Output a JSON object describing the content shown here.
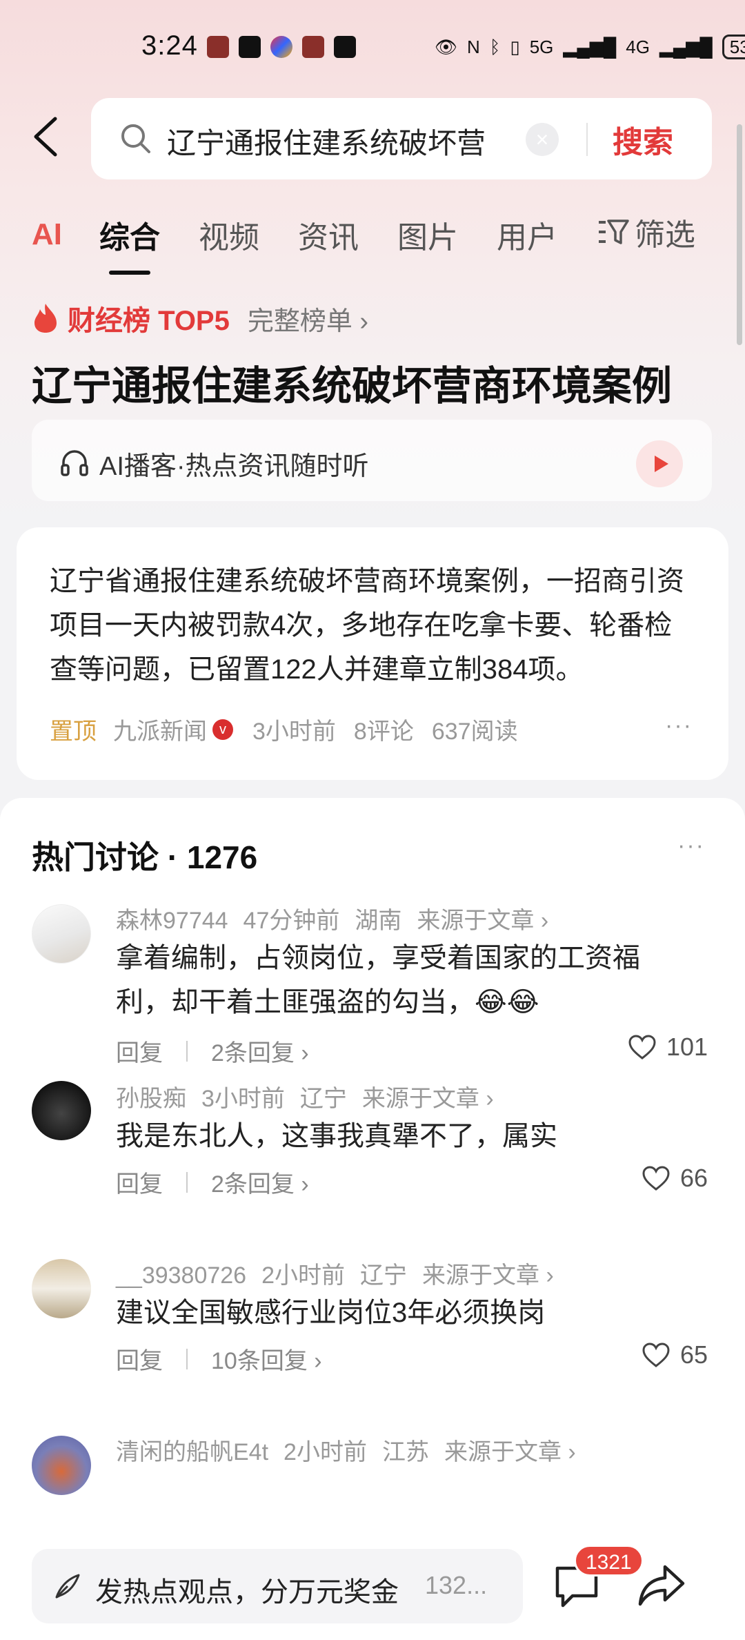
{
  "status_bar": {
    "time": "3:24",
    "signal_5g": "5G",
    "signal_4g": "4G",
    "battery": "53"
  },
  "search": {
    "query": "辽宁通报住建系统破坏营",
    "button_label": "搜索"
  },
  "tabs": [
    {
      "label": "AI"
    },
    {
      "label": "综合"
    },
    {
      "label": "视频"
    },
    {
      "label": "资讯"
    },
    {
      "label": "图片"
    },
    {
      "label": "用户"
    }
  ],
  "filter_label": "筛选",
  "rank": {
    "title": "财经榜 TOP5",
    "link": "完整榜单 ›",
    "headline": "辽宁通报住建系统破坏营商环境案例"
  },
  "podcast": {
    "text": "AI播客·热点资讯随时听"
  },
  "article": {
    "body": "辽宁省通报住建系统破坏营商环境案例，一招商引资项目一天内被罚款4次，多地存在吃拿卡要、轮番检查等问题，已留置122人并建章立制384项。",
    "pin": "置顶",
    "source": "九派新闻",
    "time": "3小时前",
    "comments": "8评论",
    "reads": "637阅读",
    "more": "···"
  },
  "discussion": {
    "title": "热门讨论 · 1276",
    "more": "···",
    "items": [
      {
        "user": "森林97744",
        "time": "47分钟前",
        "region": "湖南",
        "origin": "来源于文章 ›",
        "text": "拿着编制，占领岗位，享受着国家的工资福利，却干着土匪强盗的勾当，😂😂",
        "reply": "回复",
        "replies": "2条回复 ›",
        "likes": "101"
      },
      {
        "user": "孙股痴",
        "time": "3小时前",
        "region": "辽宁",
        "origin": "来源于文章 ›",
        "text": "我是东北人，这事我真犟不了，属实",
        "reply": "回复",
        "replies": "2条回复 ›",
        "likes": "66"
      },
      {
        "user": "__39380726",
        "time": "2小时前",
        "region": "辽宁",
        "origin": "来源于文章 ›",
        "text": "建议全国敏感行业岗位3年必须换岗",
        "reply": "回复",
        "replies": "10条回复 ›",
        "likes": "65"
      },
      {
        "user": "清闲的船帆E4t",
        "time": "2小时前",
        "region": "江苏",
        "origin": "来源于文章 ›"
      }
    ]
  },
  "bottom": {
    "input_text": "发热点观点，分万元奖金",
    "input_count": "132...",
    "comment_count": "1321"
  },
  "colors": {
    "accent_red": "#e23a3a",
    "pin_gold": "#d8a040"
  }
}
